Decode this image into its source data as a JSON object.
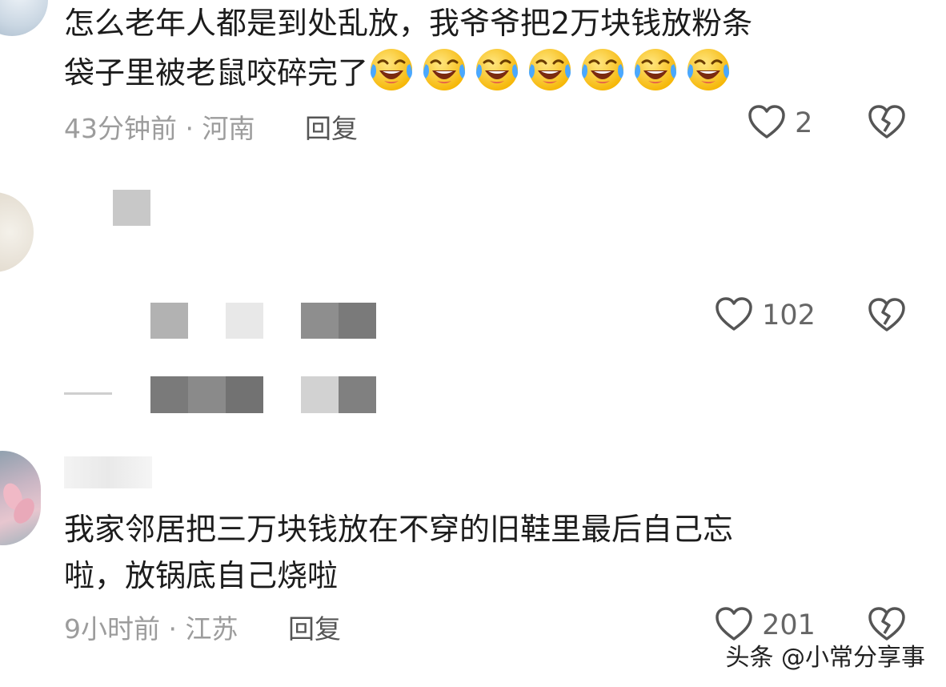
{
  "comments": [
    {
      "text_line1": "怎么老年人都是到处乱放，我爷爷把2万块钱放粉条",
      "text_line2": "袋子里被老鼠咬碎完了",
      "emoji_icon": "laughing-crying-emoji",
      "emoji_count": 7,
      "time": "43分钟前",
      "location": "河南",
      "separator": "·",
      "reply_label": "回复",
      "likes": "2"
    },
    {
      "text_blurred": true,
      "likes": "102"
    },
    {
      "text_line1": "我家邻居把三万块钱放在不穿的旧鞋里最后自己忘",
      "text_line2": "啦，放锅底自己烧啦",
      "time": "9小时前",
      "location": "江苏",
      "separator": "·",
      "reply_label": "回复",
      "likes": "201"
    }
  ],
  "icons": {
    "like": "heart-outline-icon",
    "dislike": "broken-heart-icon"
  },
  "watermark": "头条 @小常分享事",
  "colors": {
    "text": "#1c1c1c",
    "meta": "#9c9c9c",
    "icon": "#555555"
  }
}
